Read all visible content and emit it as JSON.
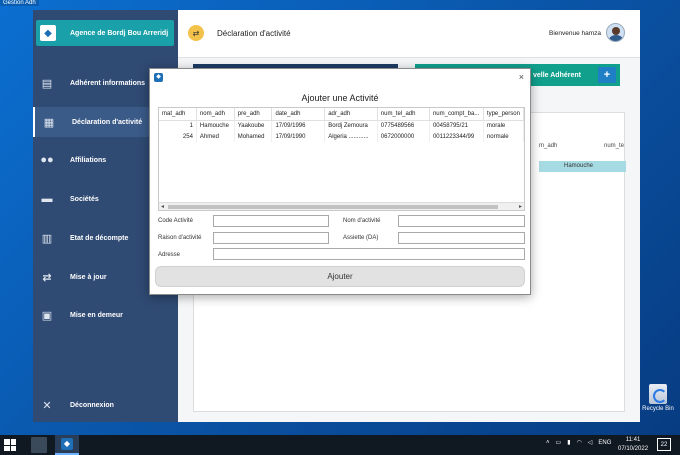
{
  "window_title": "Gestion Adh",
  "sidebar": {
    "brand": "Agence de Bordj Bou Arreridj",
    "items": [
      {
        "label": "Adhérent informations",
        "icon": "id-card-icon"
      },
      {
        "label": "Déclaration d'activité",
        "icon": "document-icon"
      },
      {
        "label": "Affiliations",
        "icon": "users-icon"
      },
      {
        "label": "Sociétés",
        "icon": "briefcase-icon"
      },
      {
        "label": "Etat de décompte",
        "icon": "report-icon"
      },
      {
        "label": "Mise à jour",
        "icon": "refresh-icon"
      },
      {
        "label": "Mise en demeur",
        "icon": "alert-icon"
      },
      {
        "label": "Déconnexion",
        "icon": "close-icon"
      }
    ]
  },
  "header": {
    "title": "Déclaration d'activité",
    "welcome": "Bienvenue hamza"
  },
  "background": {
    "add_button": "velle Adhérent",
    "add_plus": "+",
    "columns": [
      "m_adh",
      "num_te"
    ],
    "row_value": "Hamouche"
  },
  "dialog": {
    "title": "Ajouter une Activité",
    "close": "×",
    "table": {
      "columns": [
        "mat_adh",
        "nom_adh",
        "pre_adh",
        "date_adh",
        "adr_adh",
        "num_tel_adh",
        "num_compt_ba...",
        "type_person"
      ],
      "rows": [
        [
          "1",
          "Hamouche",
          "Yaakoube",
          "17/09/1996",
          "Bordj Zemoura",
          "0775489566",
          "00458795/21",
          "morale"
        ],
        [
          "254",
          "Ahmed",
          "Mohamed",
          "17/09/1990",
          "Algeria ............",
          "0672000000",
          "0011223344/99",
          "normale"
        ]
      ]
    },
    "fields": {
      "code_label": "Code Activité",
      "nom_label": "Nom d'activité",
      "raison_label": "Raison d'activité",
      "assiette_label": "Assiette (DA)",
      "adresse_label": "Adresse",
      "code_value": "",
      "nom_value": "",
      "raison_value": "",
      "assiette_value": "",
      "adresse_value": ""
    },
    "submit": "Ajouter"
  },
  "desktop": {
    "recycle_bin": "Recycle Bin"
  },
  "taskbar": {
    "language": "ENG",
    "time": "11:41",
    "date": "07/10/2022",
    "notifications": "22"
  }
}
